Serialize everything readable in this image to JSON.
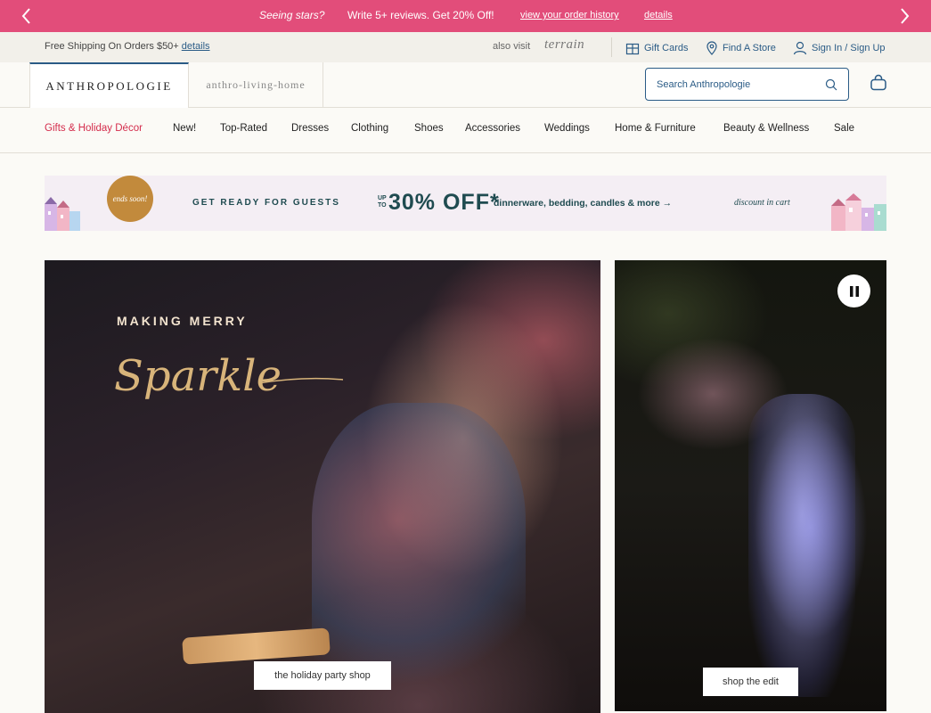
{
  "promo_bar": {
    "lead": "Seeing stars?",
    "message": "Write 5+ reviews. Get 20% Off!",
    "link_history": "view your order history",
    "link_details": "details"
  },
  "utility": {
    "shipping": "Free Shipping On Orders $50+",
    "shipping_link": "details",
    "also_visit": "also visit",
    "terrain": "terrain",
    "gift_cards": "Gift Cards",
    "find_store": "Find A Store",
    "sign_in": "Sign In / Sign Up"
  },
  "header": {
    "logo": "ANTHROPOLOGIE",
    "home_tab": "anthro-living-home",
    "search_placeholder": "Search Anthropologie"
  },
  "nav": {
    "items": [
      "Gifts & Holiday Décor",
      "New!",
      "Top-Rated",
      "Dresses",
      "Clothing",
      "Shoes",
      "Accessories",
      "Weddings",
      "Home & Furniture",
      "Beauty & Wellness",
      "Sale"
    ]
  },
  "banner": {
    "badge": "ends soon!",
    "headline": "GET READY FOR GUESTS",
    "up_to": "UP TO",
    "percent": "30% OFF*",
    "deal": "dinnerware, bedding, candles & more →",
    "cart_note": "discount in cart"
  },
  "hero_left": {
    "eyebrow": "MAKING MERRY",
    "script": "Sparkle",
    "cta": "the holiday party shop"
  },
  "hero_right": {
    "cta": "shop the edit"
  },
  "colors": {
    "promo_pink": "#e24d7a",
    "brand_blue": "#2a5b86",
    "holiday_red": "#d42c4c",
    "banner_teal": "#1f4b50"
  },
  "icons": [
    "chevron-left-icon",
    "chevron-right-icon",
    "gift-icon",
    "location-pin-icon",
    "user-icon",
    "search-icon",
    "shopping-bag-icon",
    "pause-icon"
  ]
}
